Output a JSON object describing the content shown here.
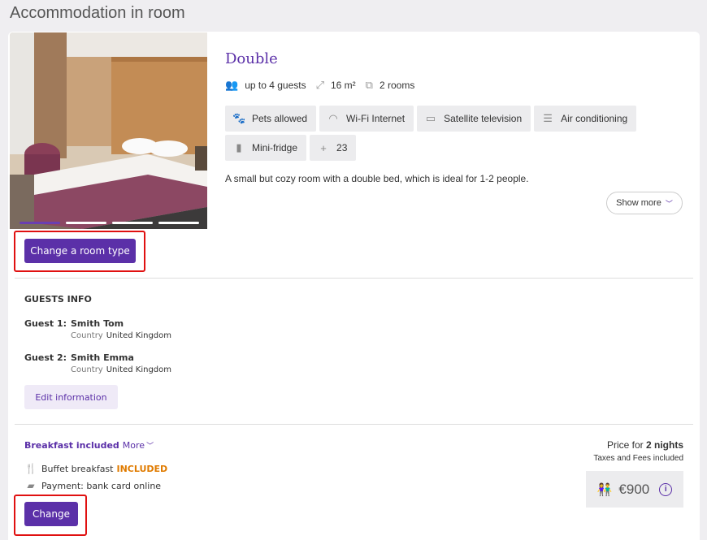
{
  "page": {
    "title": "Accommodation in room"
  },
  "room": {
    "name": "Double",
    "guests": "up to 4 guests",
    "area": "16 m²",
    "rooms": "2 rooms",
    "amenities": [
      {
        "icon": "paw-icon",
        "label": "Pets allowed"
      },
      {
        "icon": "wifi-icon",
        "label": "Wi-Fi Internet"
      },
      {
        "icon": "tv-icon",
        "label": "Satellite television"
      },
      {
        "icon": "air-conditioning-icon",
        "label": "Air conditioning"
      },
      {
        "icon": "fridge-icon",
        "label": "Mini-fridge"
      },
      {
        "icon": "plus-icon",
        "label": "23"
      }
    ],
    "description": "A small but cozy room with a double bed, which is ideal for 1-2 people.",
    "show_more_label": "Show more",
    "change_room_label": "Change a room type",
    "photo_slides": 4,
    "active_slide": 1
  },
  "guests_info": {
    "title": "GUESTS INFO",
    "country_label": "Country",
    "guests": [
      {
        "label": "Guest 1:",
        "name": "Smith Tom",
        "country": "United Kingdom"
      },
      {
        "label": "Guest 2:",
        "name": "Smith Emma",
        "country": "United Kingdom"
      }
    ],
    "edit_label": "Edit information"
  },
  "meal": {
    "title": "Breakfast included",
    "more_label": "More",
    "breakfast_label": "Buffet breakfast",
    "included_label": "INCLUDED",
    "payment_label": "Payment: bank card online",
    "change_label": "Change"
  },
  "price": {
    "label_prefix": "Price for",
    "nights": "2 nights",
    "taxes": "Taxes and Fees included",
    "amount": "€900"
  },
  "colors": {
    "accent": "#5b30a8",
    "highlight": "#e01010",
    "included": "#e07b00"
  }
}
